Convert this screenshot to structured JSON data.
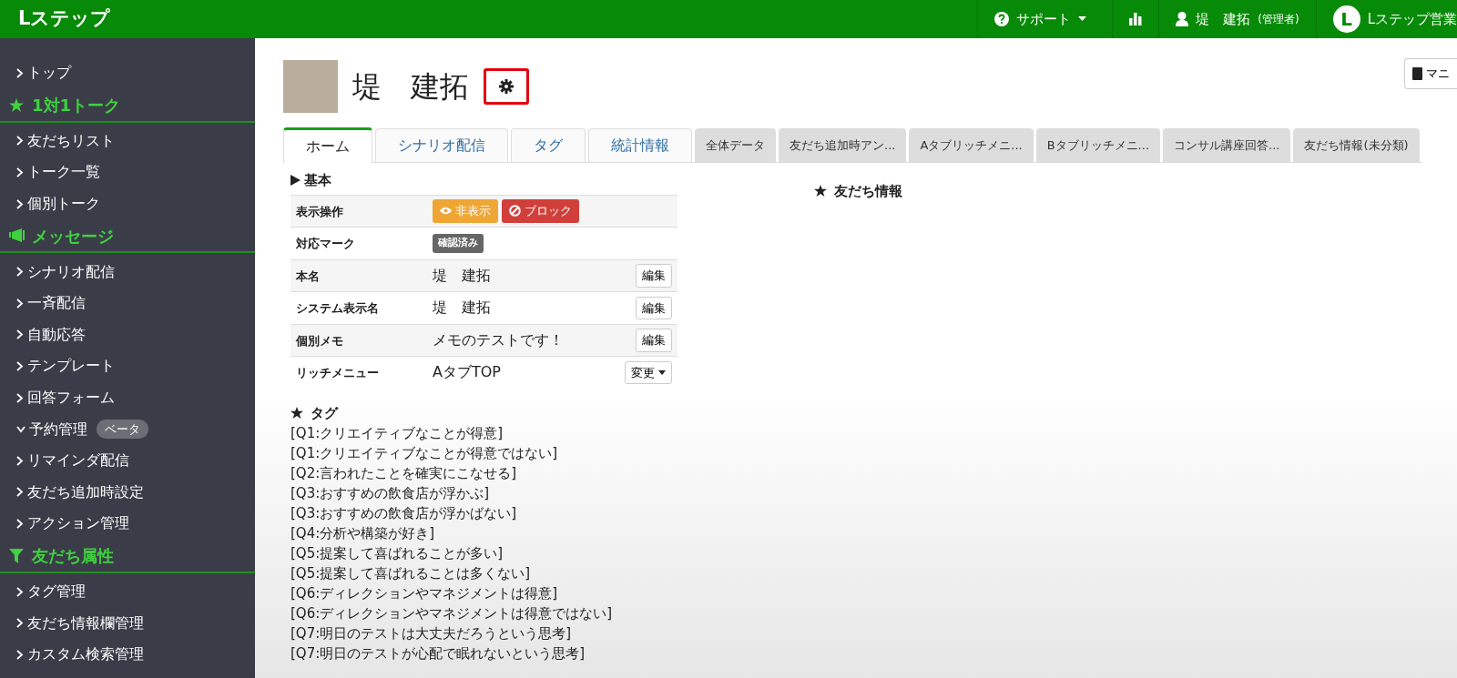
{
  "navbar": {
    "brand": "Lステップ",
    "support": "サポート",
    "user_name": "堤　建拓",
    "user_role": "(管理者)",
    "account_logo": "L",
    "account_name": "Lステップ営業"
  },
  "sidebar": {
    "items": [
      {
        "kind": "link",
        "label": "トップ"
      },
      {
        "kind": "header",
        "label": "1対1トーク"
      },
      {
        "kind": "link",
        "label": "友だちリスト"
      },
      {
        "kind": "link",
        "label": "トーク一覧"
      },
      {
        "kind": "link",
        "label": "個別トーク"
      },
      {
        "kind": "header",
        "label": "メッセージ"
      },
      {
        "kind": "link",
        "label": "シナリオ配信"
      },
      {
        "kind": "link",
        "label": "一斉配信"
      },
      {
        "kind": "link",
        "label": "自動応答"
      },
      {
        "kind": "link",
        "label": "テンプレート"
      },
      {
        "kind": "link",
        "label": "回答フォーム"
      },
      {
        "kind": "link",
        "label": "予約管理",
        "expanded": true,
        "badge": "ベータ"
      },
      {
        "kind": "link",
        "label": "リマインダ配信"
      },
      {
        "kind": "link",
        "label": "友だち追加時設定"
      },
      {
        "kind": "link",
        "label": "アクション管理"
      },
      {
        "kind": "header",
        "label": "友だち属性"
      },
      {
        "kind": "link",
        "label": "タグ管理"
      },
      {
        "kind": "link",
        "label": "友だち情報欄管理"
      },
      {
        "kind": "link",
        "label": "カスタム検索管理"
      }
    ]
  },
  "profile": {
    "name": "堤　建拓",
    "manual_button": "マニ"
  },
  "tabs": [
    {
      "kind": "main",
      "label": "ホーム",
      "selected": true
    },
    {
      "kind": "main",
      "label": "シナリオ配信",
      "selected": false
    },
    {
      "kind": "main",
      "label": "タグ",
      "selected": false
    },
    {
      "kind": "main",
      "label": "統計情報",
      "selected": false
    },
    {
      "kind": "custom",
      "label": "全体データ",
      "selected": false
    },
    {
      "kind": "custom",
      "label": "友だち追加時アン...",
      "selected": false
    },
    {
      "kind": "custom",
      "label": "Aタブリッチメニ...",
      "selected": false
    },
    {
      "kind": "custom",
      "label": "Bタブリッチメニ...",
      "selected": false
    },
    {
      "kind": "custom",
      "label": "コンサル講座回答...",
      "selected": false
    },
    {
      "kind": "custom",
      "label": "友だち情報(未分類)",
      "selected": false
    }
  ],
  "basic": {
    "title": "基本",
    "rows": [
      {
        "kind": "actions",
        "label": "表示操作",
        "hide_button": "非表示",
        "block_button": "ブロック"
      },
      {
        "kind": "mark",
        "label": "対応マーク",
        "badge": "確認済み"
      },
      {
        "kind": "editable",
        "label": "本名",
        "value": "堤　建拓",
        "button": "編集"
      },
      {
        "kind": "editable",
        "label": "システム表示名",
        "value": "堤　建拓",
        "button": "編集"
      },
      {
        "kind": "editable",
        "label": "個別メモ",
        "value": "メモのテストです！",
        "button": "編集"
      },
      {
        "kind": "menu",
        "label": "リッチメニュー",
        "value": "AタブTOP",
        "button": "変更"
      }
    ]
  },
  "tags": {
    "title": "タグ",
    "items": [
      "[Q1:クリエイティブなことが得意]",
      "[Q1:クリエイティブなことが得意ではない]",
      "[Q2:言われたことを確実にこなせる]",
      "[Q3:おすすめの飲食店が浮かぶ]",
      "[Q3:おすすめの飲食店が浮かばない]",
      "[Q4:分析や構築が好き]",
      "[Q5:提案して喜ばれることが多い]",
      "[Q5:提案して喜ばれることは多くない]",
      "[Q6:ディレクションやマネジメントは得意]",
      "[Q6:ディレクションやマネジメントは得意ではない]",
      "[Q7:明日のテストは大丈夫だろうという思考]",
      "[Q7:明日のテストが心配で眠れないという思考]"
    ]
  },
  "friend_info": {
    "title": "友だち情報"
  }
}
